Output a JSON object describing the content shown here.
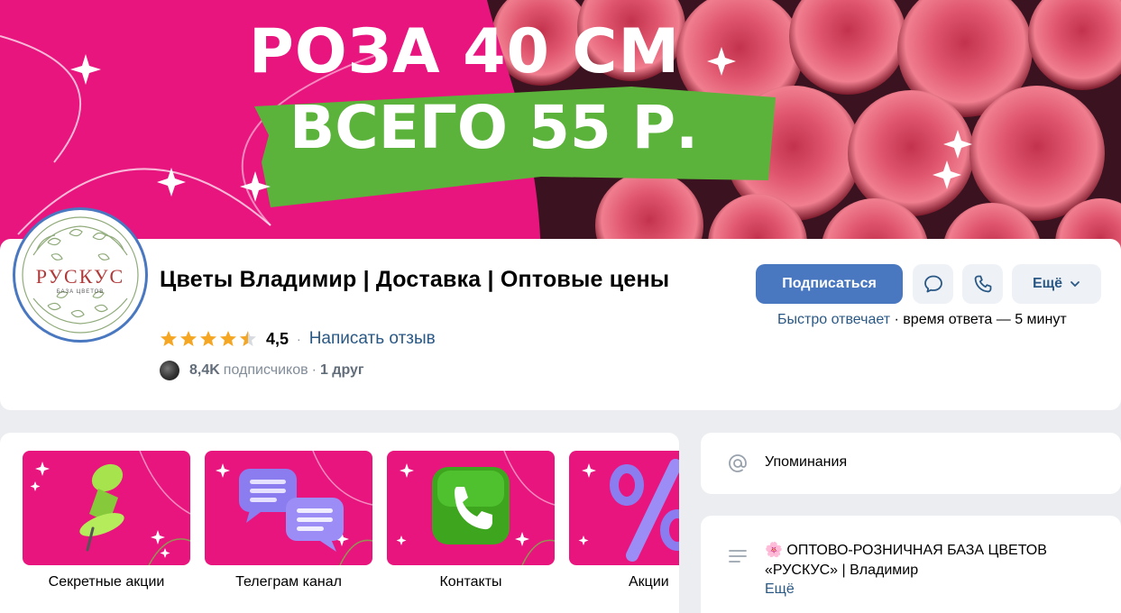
{
  "cover": {
    "headline": "РОЗА 40 СМ",
    "price": "ВСЕГО 55 Р."
  },
  "avatar": {
    "logo_word": "РУСКУС",
    "logo_sub": "БАЗА ЦВЕТОВ"
  },
  "group": {
    "name": "Цветы Владимир | Доставка | Оптовые цены",
    "rating": "4,5",
    "rating_fraction": 0.9,
    "write_review": "Написать отзыв",
    "subscribers_count": "8,4K",
    "subscribers_label": "подписчиков",
    "friends": "1 друг"
  },
  "actions": {
    "subscribe": "Подписаться",
    "more": "Ещё",
    "message_icon": "chat-bubble-icon",
    "call_icon": "phone-icon"
  },
  "response": {
    "fast": "Быстро отвечает",
    "time": "время ответа — 5 минут"
  },
  "tiles": [
    {
      "label": "Секретные акции",
      "icon": "pushpin-icon"
    },
    {
      "label": "Телеграм канал",
      "icon": "chat-bubbles-icon"
    },
    {
      "label": "Контакты",
      "icon": "phone-icon"
    },
    {
      "label": "Акции",
      "icon": "percent-icon"
    }
  ],
  "sidebar": {
    "mentions": "Упоминания",
    "about_emoji": "🌸",
    "about_text": "ОПТОВО-РОЗНИЧНАЯ БАЗА ЦВЕТОВ «РУСКУС» | Владимир",
    "about_more": "Ещё"
  },
  "colors": {
    "brand_pink": "#e8157f",
    "accent_blue": "#4a78c0",
    "link_blue": "#2a5885",
    "banner_green": "#5bb33b",
    "star": "#f5a623"
  }
}
